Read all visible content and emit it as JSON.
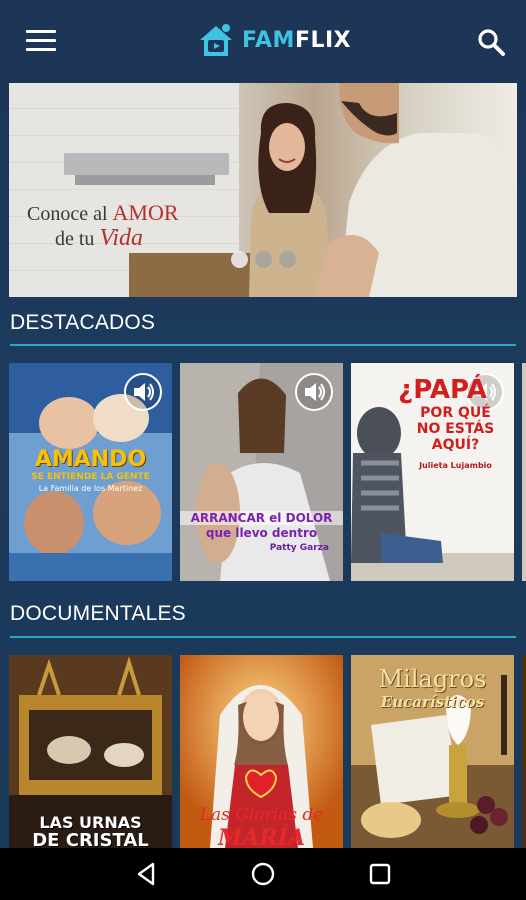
{
  "app": {
    "brand_prefix": "FAM",
    "brand_suffix": "FLIX"
  },
  "hero": {
    "title_line1_prefix": "Conoce al ",
    "title_line1_accent": "AMOR",
    "title_line2_prefix": "de tu ",
    "title_line2_accent": "Vida",
    "dots_count": 3,
    "active_dot": 1
  },
  "sections": [
    {
      "title": "DESTACADOS",
      "items": [
        {
          "title": "AMANDO",
          "title2": "SE ENTIENDE LA GENTE",
          "subtitle": "La Familia de los Martinez",
          "has_sound": true
        },
        {
          "title": "ARRANCAR el DOLOR",
          "title2": "que llevo dentro",
          "subtitle": "Patty Garza",
          "has_sound": true
        },
        {
          "title": "¿PAPÁ",
          "title2": "POR QUÉ",
          "title3": "NO ESTÁS",
          "title4": "AQUÍ?",
          "subtitle": "Julieta Lujambio",
          "has_sound": true
        }
      ]
    },
    {
      "title": "DOCUMENTALES",
      "items": [
        {
          "title": "LAS URNAS",
          "title2": "DE CRISTAL"
        },
        {
          "title": "Las Glorias de",
          "title2": "MARÍA"
        },
        {
          "title": "Milagros",
          "title2": "Eucarísticos"
        }
      ]
    }
  ],
  "colors": {
    "accent": "#2aa7c4",
    "brand_cyan": "#3ec3e0",
    "hero_accent": "#b3322e",
    "background": "#1d3557"
  },
  "icons": {
    "menu": "menu-icon",
    "search": "search-icon",
    "sound": "sound-icon",
    "back": "back-triangle-icon",
    "home": "home-circle-icon",
    "recents": "recents-square-icon"
  }
}
